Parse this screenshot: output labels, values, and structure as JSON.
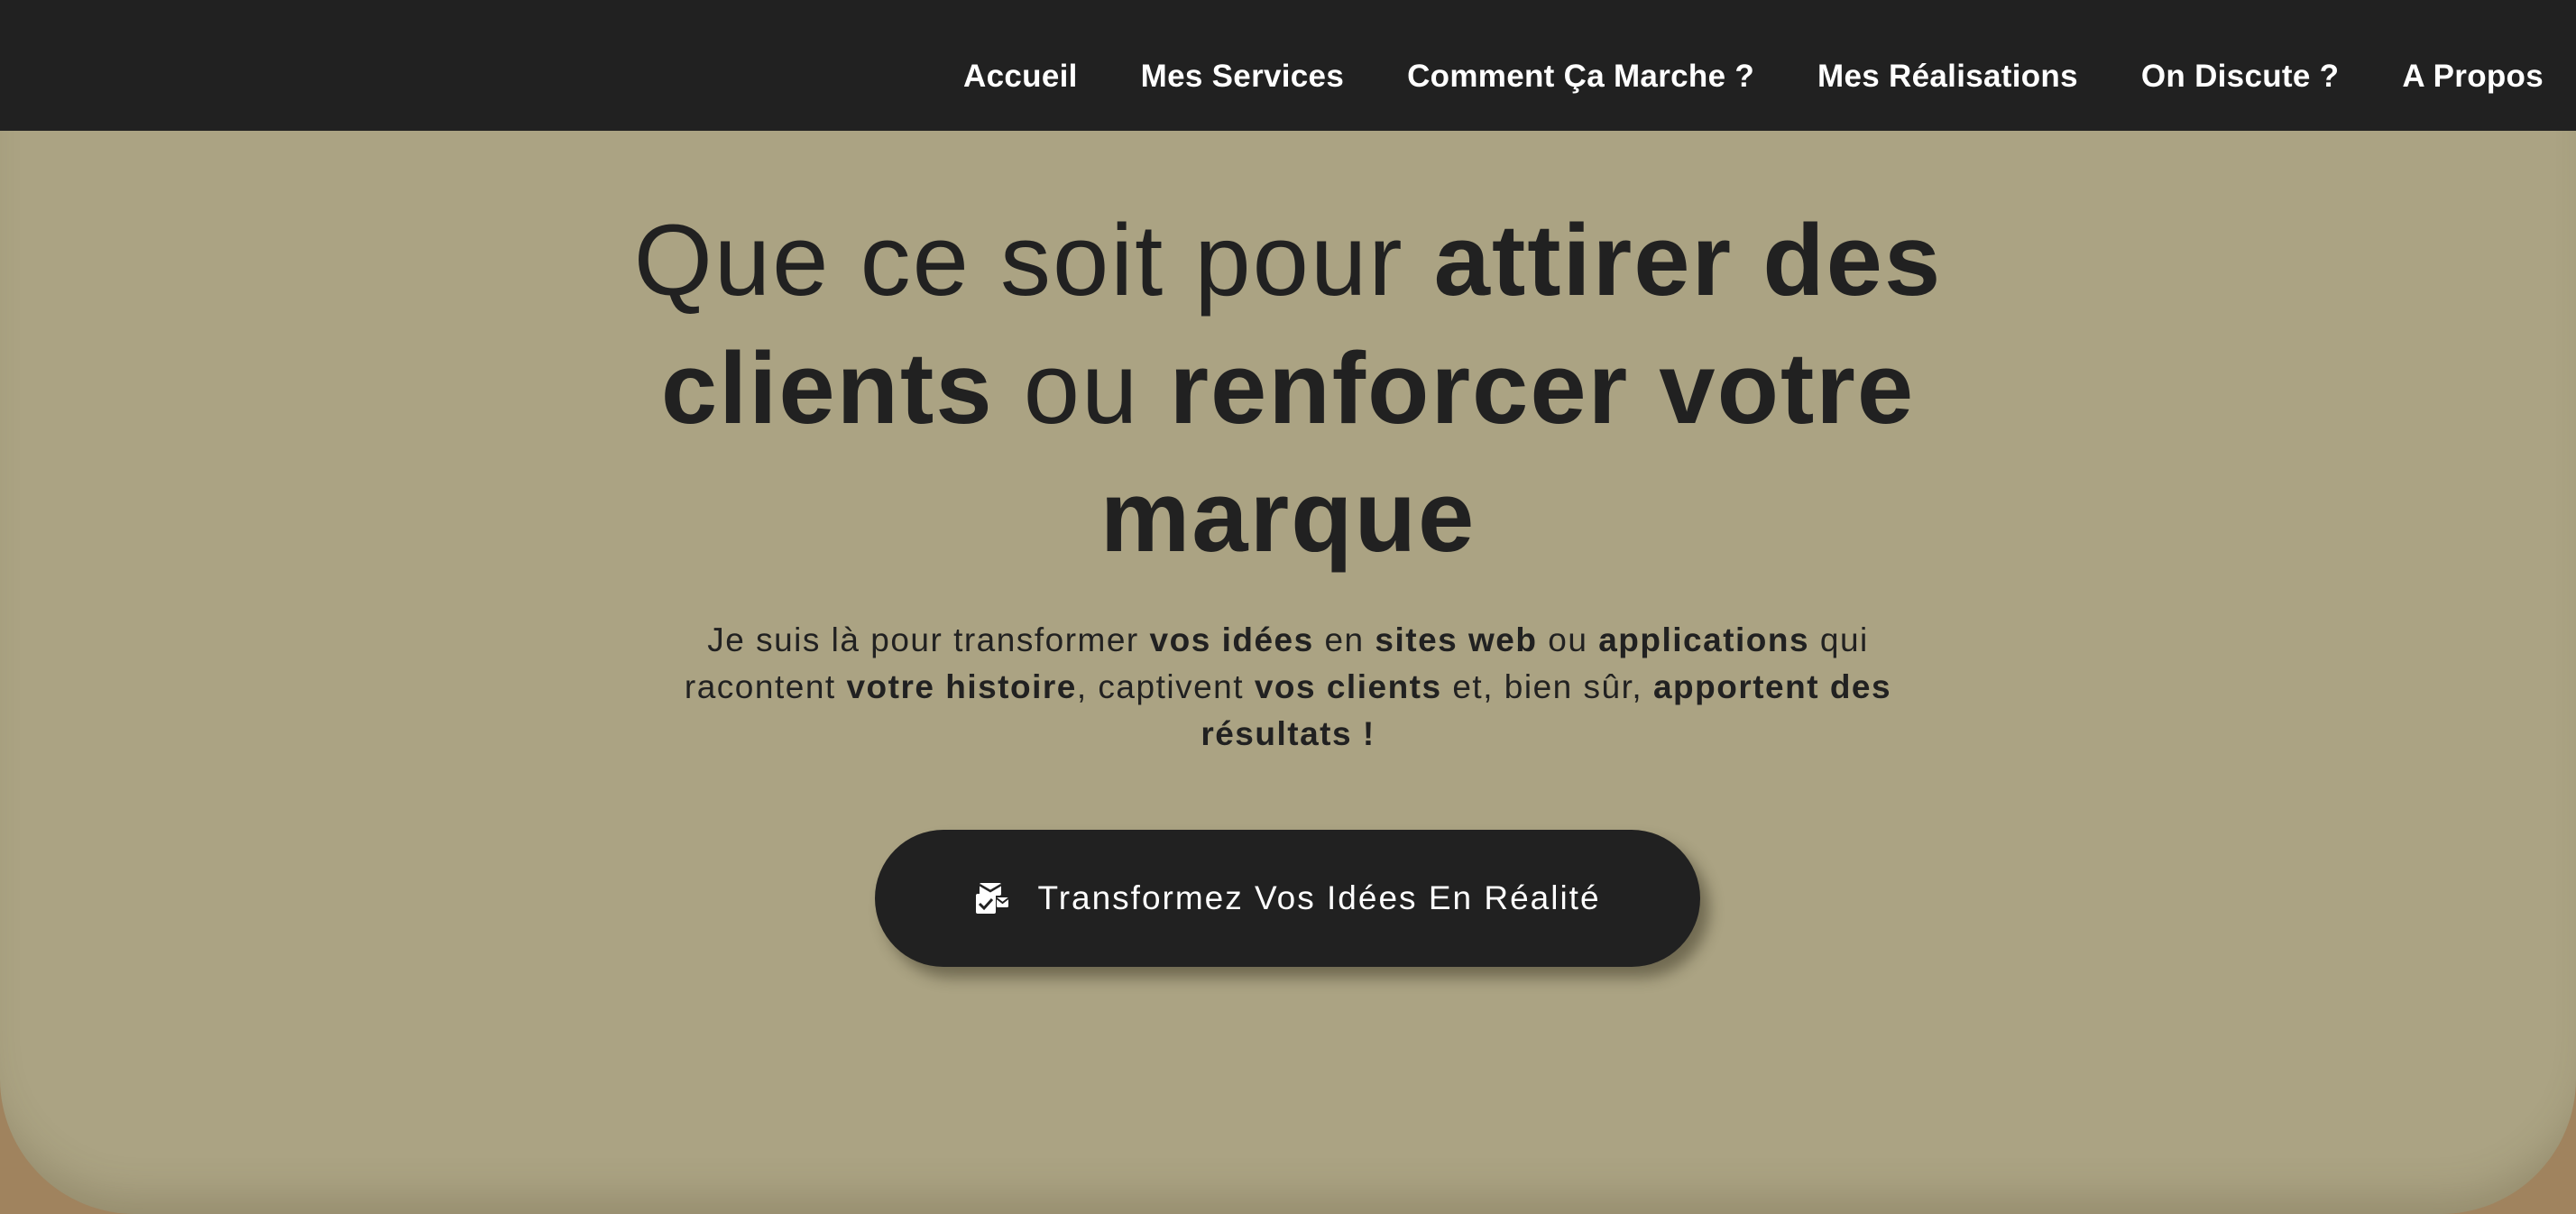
{
  "nav": {
    "items": [
      {
        "label": "Accueil"
      },
      {
        "label": "Mes Services"
      },
      {
        "label": "Comment Ça Marche ?"
      },
      {
        "label": "Mes Réalisations"
      },
      {
        "label": "On Discute ?"
      },
      {
        "label": "A Propos"
      }
    ]
  },
  "hero": {
    "headline": {
      "part1": "Que ce soit pour ",
      "part2": "attirer des clients",
      "part3": " ou ",
      "part4": "renforcer votre marque"
    },
    "subtitle": {
      "s1": "Je suis là pour transformer ",
      "s2": "vos idées",
      "s3": " en ",
      "s4": "sites web",
      "s5": " ou ",
      "s6": "applications",
      "s7": " qui racontent ",
      "s8": "votre histoire",
      "s9": ", captivent ",
      "s10": "vos clients",
      "s11": " et, bien sûr, ",
      "s12": "apportent des résultats !"
    },
    "cta": {
      "label": "Transformez Vos Idées En Réalité",
      "icon": "mail-check-icon"
    }
  },
  "colors": {
    "navbar_bg": "#212121",
    "hero_bg": "#aba383",
    "page_bg": "#a0835e",
    "text": "#212121",
    "button_bg": "#212121",
    "button_text": "#ffffff"
  }
}
